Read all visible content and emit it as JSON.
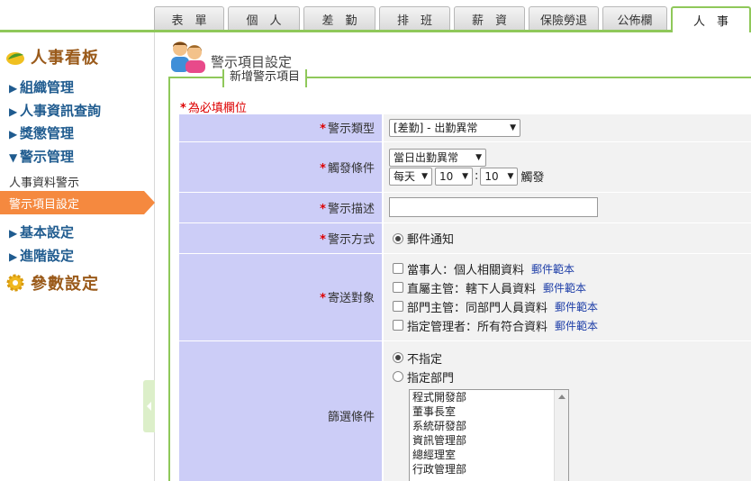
{
  "tabs": [
    "表　單",
    "個　人",
    "差　勤",
    "排　班",
    "薪　資",
    "保險勞退",
    "公佈欄",
    "人　事"
  ],
  "sidebar": {
    "header1": "人事看板",
    "items": {
      "org": "組織管理",
      "query": "人事資訊查詢",
      "reward": "獎懲管理",
      "alert": "警示管理",
      "basic": "基本設定",
      "advanced": "進階設定"
    },
    "subs": {
      "alert_list": "人事資料警示",
      "alert_setting": "警示項目設定"
    },
    "header2": "參數設定"
  },
  "page": {
    "title": "警示項目設定",
    "legend": "新增警示項目",
    "required_note": "為必填欄位"
  },
  "form": {
    "type_label": "警示類型",
    "type_value": "[差勤] - 出勤異常",
    "trigger_label": "觸發條件",
    "trigger_value": "當日出勤異常",
    "freq_value": "每天",
    "hour_value": "10",
    "minute_value": "10",
    "colon": ":",
    "trigger_suffix": "觸發",
    "desc_label": "警示描述",
    "desc_value": "",
    "method_label": "警示方式",
    "method_value": "郵件通知",
    "target_label": "寄送對象",
    "targets": [
      {
        "text": "當事人：個人相關資料",
        "link": "郵件範本"
      },
      {
        "text": "直屬主管：轄下人員資料",
        "link": "郵件範本"
      },
      {
        "text": "部門主管：同部門人員資料",
        "link": "郵件範本"
      },
      {
        "text": "指定管理者：所有符合資料",
        "link": "郵件範本"
      }
    ],
    "filter_label": "篩選條件",
    "filter_opt1": "不指定",
    "filter_opt2": "指定部門",
    "departments": [
      "程式開發部",
      "董事長室",
      "系統研發部",
      "資訊管理部",
      "總經理室",
      "行政管理部"
    ]
  },
  "colors": {
    "accent_green": "#8fc85a",
    "active_orange": "#f5893f",
    "label_bg": "#cccdf7",
    "required_red": "#dd0000",
    "link_blue": "#1f3fa8"
  }
}
